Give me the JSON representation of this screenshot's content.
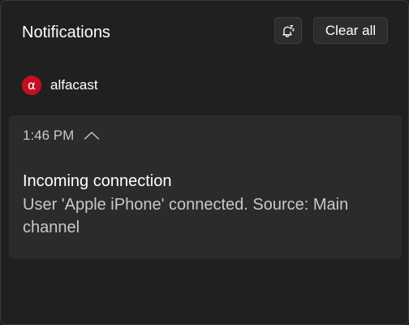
{
  "header": {
    "title": "Notifications",
    "dnd_icon": "bell-snooze-icon",
    "clear_all_label": "Clear all"
  },
  "app": {
    "icon_glyph": "α",
    "icon_color": "#c50f1f",
    "name": "alfacast"
  },
  "notification": {
    "time": "1:46 PM",
    "collapse_icon": "chevron-up-icon",
    "title": "Incoming connection",
    "body": "User 'Apple iPhone' connected. Source: Main channel"
  }
}
